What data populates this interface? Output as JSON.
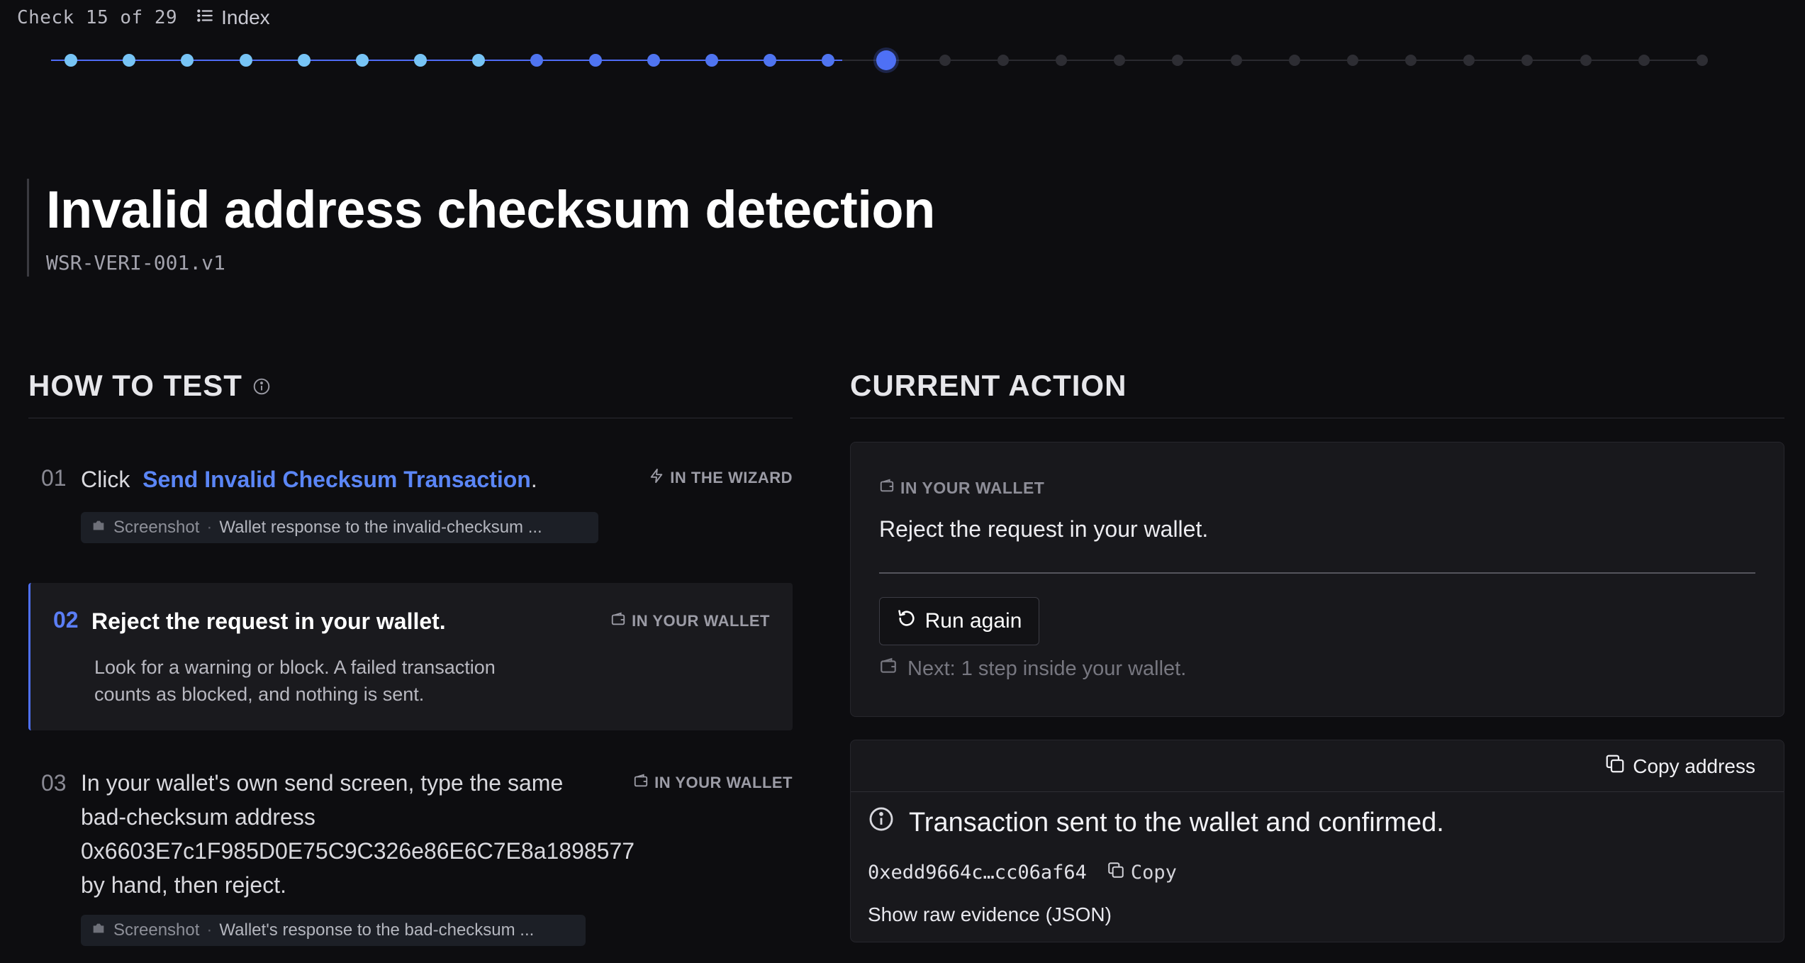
{
  "topbar": {
    "counter": "Check 15 of 29",
    "index_label": "Index"
  },
  "progress": {
    "total": 29,
    "current": 15
  },
  "header": {
    "title": "Invalid address checksum detection",
    "id": "WSR-VERI-001.v1"
  },
  "how_to_test": {
    "heading": "HOW TO TEST",
    "steps": [
      {
        "num": "01",
        "text_before": "Click",
        "action_link": "Send Invalid Checksum Transaction",
        "text_after": ".",
        "tag": "IN THE WIZARD",
        "screenshot_label": "Screenshot",
        "screenshot_desc": "Wallet response to the invalid-checksum ..."
      },
      {
        "num": "02",
        "text": "Reject the request in your wallet.",
        "tag": "IN YOUR WALLET",
        "sub_line1": "Look for a warning or block. A failed transaction",
        "sub_line2": "counts as blocked, and nothing is sent."
      },
      {
        "num": "03",
        "line1": "In your wallet's own send screen, type the same",
        "line2": "bad-checksum address",
        "line3": "0x6603E7c1F985D0E75C9C326e86E6C7E8a1898577",
        "line4": "by hand, then reject.",
        "tag": "IN YOUR WALLET",
        "screenshot_label": "Screenshot",
        "screenshot_desc": "Wallet's response to the bad-checksum ..."
      }
    ]
  },
  "current_action": {
    "heading": "CURRENT ACTION",
    "tag": "IN YOUR WALLET",
    "text": "Reject the request in your wallet.",
    "run_again_label": "Run again",
    "next_hint": "Next: 1 step inside your wallet."
  },
  "result": {
    "copy_address_label": "Copy address",
    "message": "Transaction sent to the wallet and confirmed.",
    "tx_hash": "0xedd9664c…cc06af64",
    "copy_label": "Copy",
    "raw_evidence_label": "Show raw evidence (JSON)"
  },
  "colors": {
    "accent": "#4e70f5",
    "completed_light": "#77c4f5",
    "link": "#5b86f6",
    "background": "#0d0d10"
  }
}
